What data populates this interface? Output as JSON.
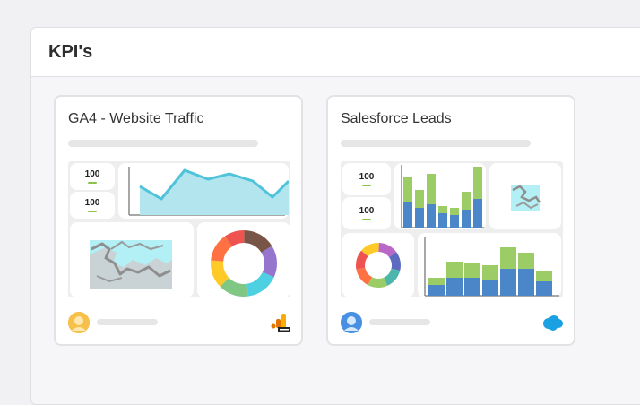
{
  "page": {
    "title": "KPI's"
  },
  "cards": [
    {
      "title": "GA4 - Website Traffic",
      "tiles": {
        "kpi_top": "100",
        "kpi_bottom": "100"
      },
      "source_icon": "google-analytics-beta-icon",
      "colors": {
        "line": "#4fc3d9",
        "area": "#b3e5ee",
        "donut": [
          "#795548",
          "#9575cd",
          "#4dd0e1",
          "#81c784",
          "#ffca28",
          "#ff7043",
          "#ef5350"
        ]
      }
    },
    {
      "title": "Salesforce Leads",
      "tiles": {
        "kpi_top": "100",
        "kpi_bottom": "100"
      },
      "source_icon": "salesforce-cloud-icon",
      "colors": {
        "bar_top": "#9ccc65",
        "bar_bottom": "#4a86c8",
        "donut": [
          "#ba68c8",
          "#5c6bc0",
          "#4db6ac",
          "#9ccc65",
          "#ff7043",
          "#ef5350",
          "#ffca28"
        ]
      }
    }
  ]
}
